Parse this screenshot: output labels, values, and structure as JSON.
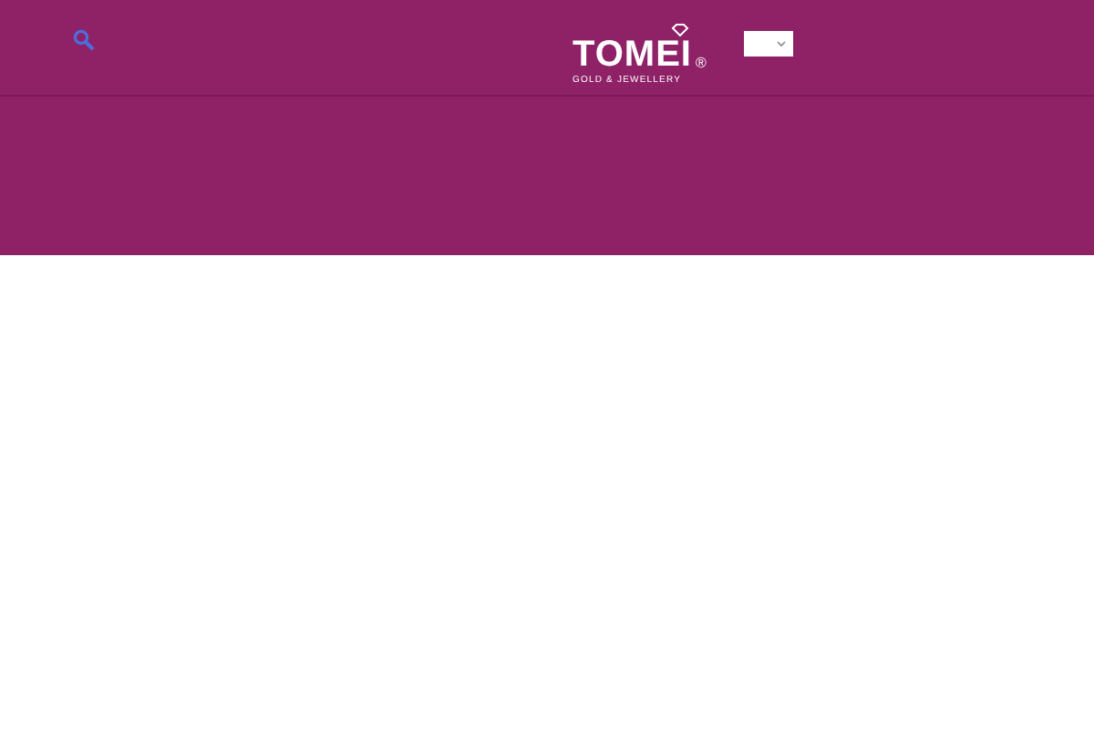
{
  "header": {
    "logo": {
      "name": "TOMEI",
      "mark": "®",
      "tagline": "GOLD & JEWELLERY"
    },
    "language_select": {
      "expanded": false
    }
  }
}
